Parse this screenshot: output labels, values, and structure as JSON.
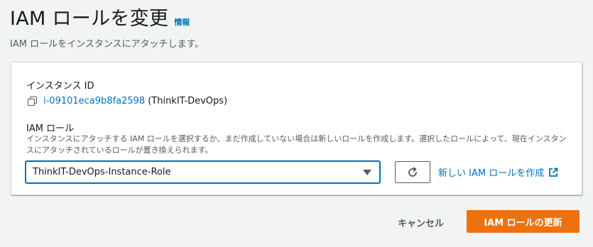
{
  "header": {
    "title": "IAM ロールを変更",
    "info_link": "情報",
    "subtitle": "IAM ロールをインスタンスにアタッチします。"
  },
  "instance": {
    "label": "インスタンス ID",
    "id": "i-09101eca9b8fa2598",
    "name": "(ThinkIT-DevOps)"
  },
  "iam_role": {
    "label": "IAM ロール",
    "description": "インスタンスにアタッチする IAM ロールを選択するか、まだ作成していない場合は新しいロールを作成します。選択したロールによって、現在インスタンスにアタッチされているロールが置き換えられます。",
    "selected": "ThinkIT-DevOps-Instance-Role",
    "create_link": "新しい IAM ロールを作成"
  },
  "footer": {
    "cancel_label": "キャンセル",
    "submit_label": "IAM ロールの更新"
  },
  "colors": {
    "link": "#0073bb",
    "primary": "#ec7211",
    "background": "#f2f3f3"
  }
}
